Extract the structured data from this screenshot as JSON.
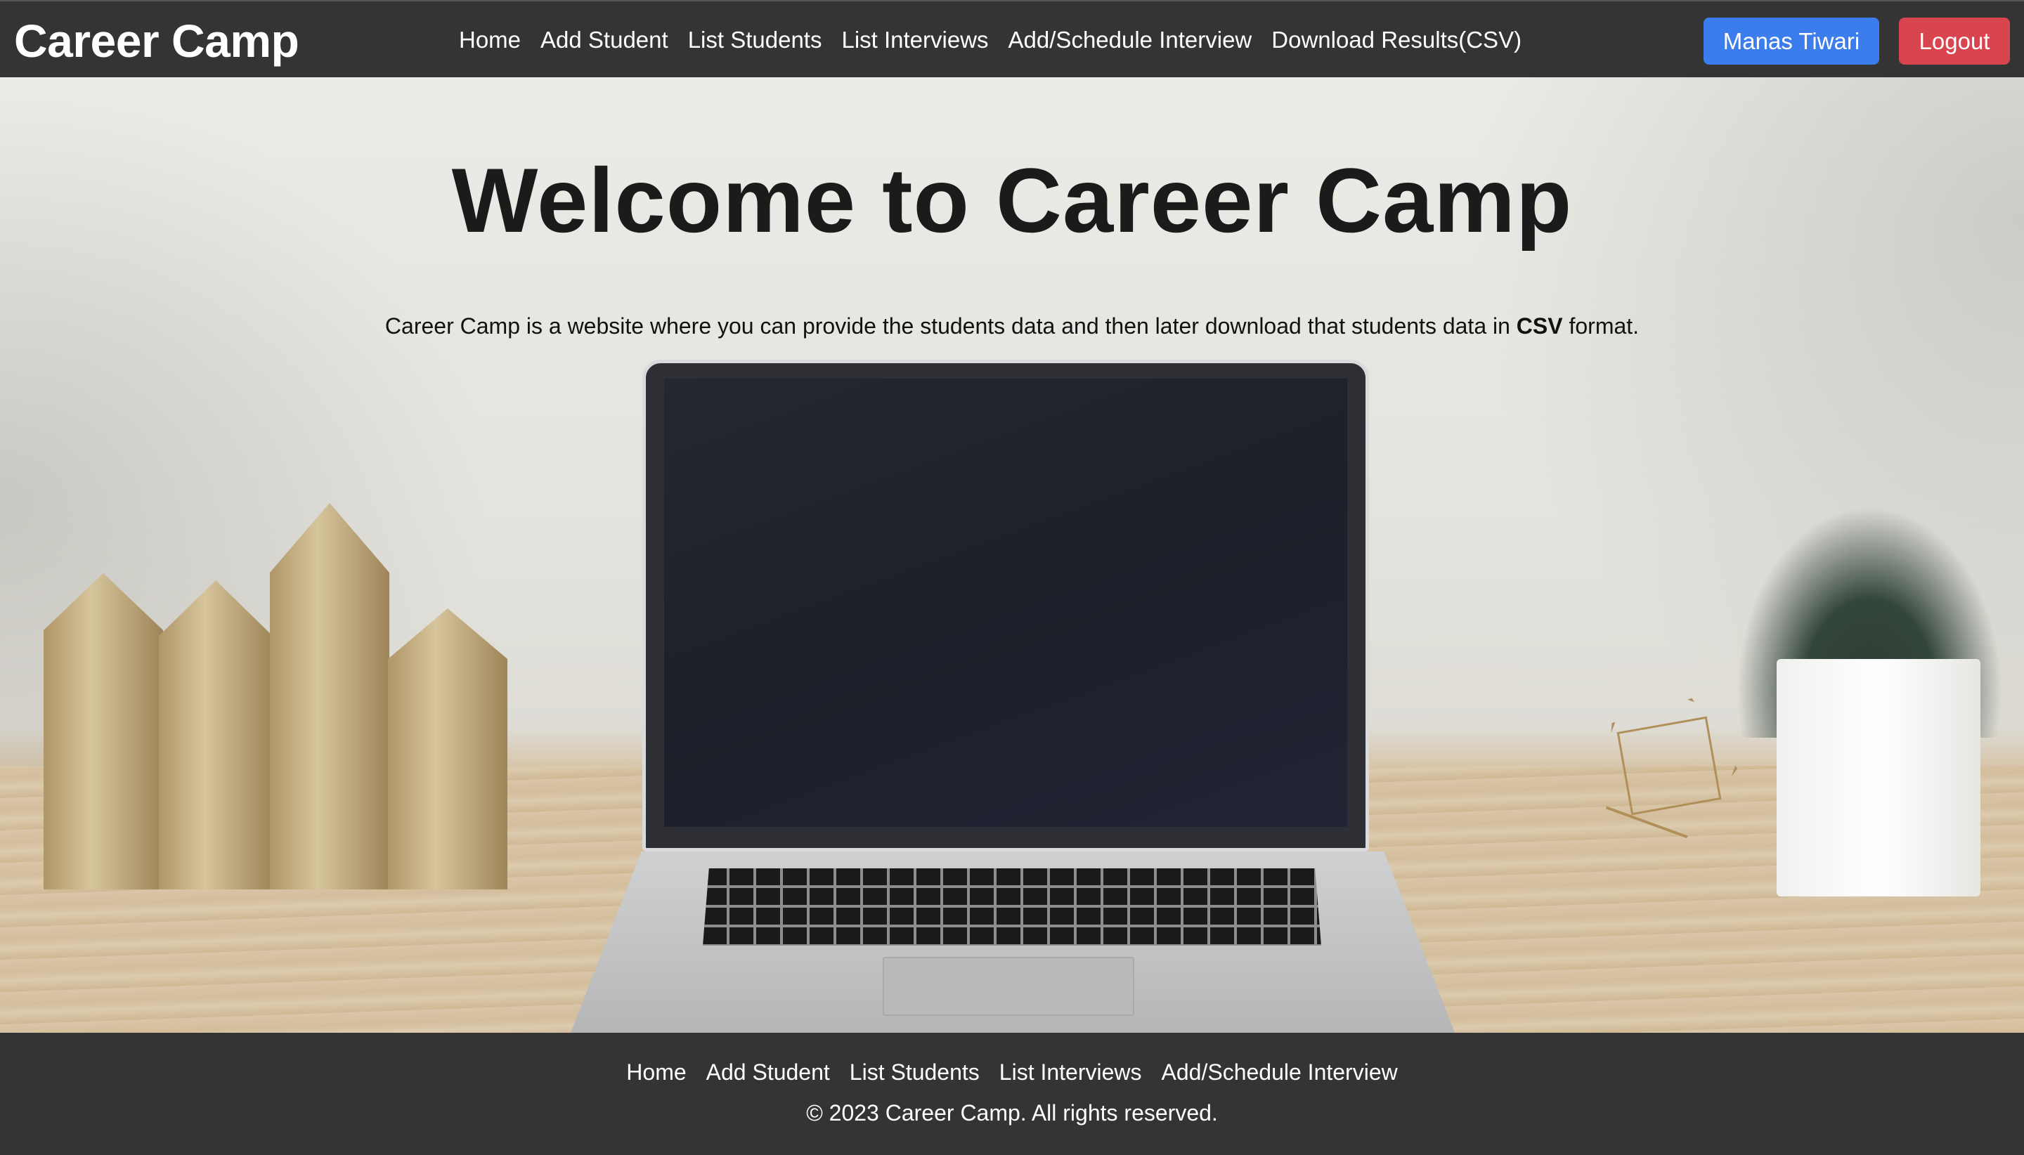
{
  "header": {
    "brand": "Career Camp",
    "nav": [
      "Home",
      "Add Student",
      "List Students",
      "List Interviews",
      "Add/Schedule Interview",
      "Download Results(CSV)"
    ],
    "user_button": "Manas Tiwari",
    "logout_button": "Logout"
  },
  "hero": {
    "title": "Welcome to Career Camp",
    "description_prefix": "Career Camp is a website where you can provide the students data and then later download that students data in ",
    "description_bold": "CSV",
    "description_suffix": " format."
  },
  "footer": {
    "nav": [
      "Home",
      "Add Student",
      "List Students",
      "List Interviews",
      "Add/Schedule Interview"
    ],
    "copyright": "© 2023 Career Camp. All rights reserved."
  },
  "colors": {
    "header_bg": "#343434",
    "user_button_bg": "#3b7ded",
    "logout_button_bg": "#d9454f"
  }
}
